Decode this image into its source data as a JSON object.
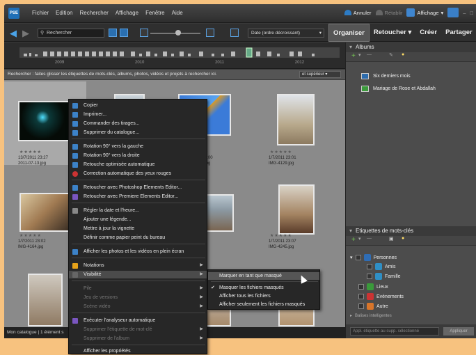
{
  "menubar": [
    "Fichier",
    "Edition",
    "Rechercher",
    "Affichage",
    "Fenêtre",
    "Aide"
  ],
  "toolbar_right": {
    "undo": "Annuler",
    "redo": "Rétablir",
    "display": "Affichage"
  },
  "search": {
    "label": "Rechercher"
  },
  "sort": {
    "value": "Date (ordre décroissant)"
  },
  "tabs": [
    "Organiser",
    "Retoucher",
    "Créer",
    "Partager"
  ],
  "timeline": {
    "years": [
      "2009",
      "2010",
      "2011",
      "2012"
    ]
  },
  "hint": {
    "text": "Rechercher : faites glisser les étiquettes de mots-clés, albums, photos, vidéos et projets à rechercher ici.",
    "operator": "et supérieur"
  },
  "photos": [
    {
      "date": "13/7/2011 23:27",
      "file": "2011-07-13.jpg"
    },
    {
      "date": "",
      "file": ""
    },
    {
      "date": "1/7/2011 23:00",
      "file": "IMG-4130.jpg"
    },
    {
      "date": "1/7/2011 23:01",
      "file": "IMG-4129.jpg"
    },
    {
      "date": "1/7/2011 23:02",
      "file": "IMG-4164.jpg"
    },
    {
      "date": "",
      "file": ""
    },
    {
      "date": "",
      "file": ""
    },
    {
      "date": "1/7/2011 23:07",
      "file": "IMG-4245.jpg"
    }
  ],
  "status": {
    "text": "Mon catalogue",
    "count": "1 élément s"
  },
  "albums_panel": {
    "title": "Albums",
    "items": [
      "Six derniers mois",
      "Mariage de Rose et Abdallah"
    ]
  },
  "keywords_panel": {
    "title": "Etiquettes de mots-clés",
    "items": [
      "Personnes",
      "Amis",
      "Famille",
      "Lieux",
      "Evénements",
      "Autre",
      "Balises intelligentes"
    ],
    "apply_placeholder": "Appl. étiquette au supp. sélectionné",
    "apply_button": "Appliquer"
  },
  "context_menu": [
    "Copier",
    "Imprimer...",
    "Commander des tirages...",
    "Supprimer du catalogue...",
    "Rotation 90° vers la gauche",
    "Rotation 90° vers la droite",
    "Retouche optimisée automatique",
    "Correction automatique des yeux rouges",
    "Retoucher avec Photoshop Elements Editor...",
    "Retoucher avec Premiere Elements Editor...",
    "Régler la date et l'heure...",
    "Ajouter une légende...",
    "Mettre à jour la vignette",
    "Définir comme papier peint du bureau",
    "Afficher les photos et les vidéos en plein écran",
    "Notations",
    "Visibilité",
    "Pile",
    "Jeu de versions",
    "Scène vidéo",
    "Exécuter l'analyseur automatique",
    "Supprimer l'étiquette de mot-clé",
    "Supprimer de l'album",
    "Afficher les propriétés"
  ],
  "submenu": [
    "Marquer en tant que masqué",
    "Masquer les fichiers masqués",
    "Afficher tous les fichiers",
    "Afficher seulement les fichiers masqués"
  ]
}
